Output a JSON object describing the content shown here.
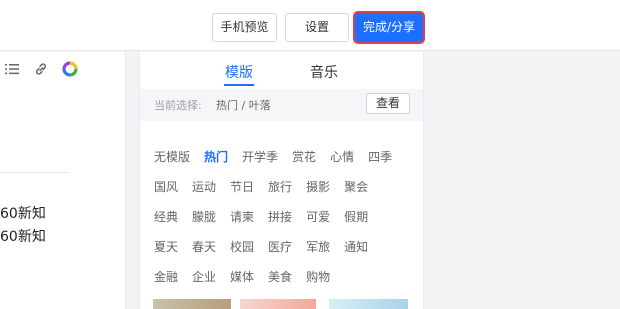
{
  "toolbar": {
    "preview_label": "手机预览",
    "settings_label": "设置",
    "done_label": "完成/分享"
  },
  "editor": {
    "icons": [
      "list-icon",
      "link-icon",
      "color-wheel-icon"
    ],
    "lines": [
      "60新知",
      "60新知"
    ]
  },
  "panel": {
    "tabs": [
      {
        "label": "模版",
        "active": true
      },
      {
        "label": "音乐",
        "active": false
      }
    ],
    "selection_label": "当前选择:",
    "selection_value": "热门 / 叶落",
    "view_button": "查看",
    "categories": [
      [
        "无模版",
        "热门",
        "开学季",
        "赏花",
        "心情",
        "四季"
      ],
      [
        "国风",
        "运动",
        "节日",
        "旅行",
        "摄影",
        "聚会"
      ],
      [
        "经典",
        "朦胧",
        "请柬",
        "拼接",
        "可爱",
        "假期"
      ],
      [
        "夏天",
        "春天",
        "校园",
        "医疗",
        "军旅",
        "通知"
      ],
      [
        "金融",
        "企业",
        "媒体",
        "美食",
        "购物"
      ]
    ],
    "active_category": "热门"
  },
  "colors": {
    "accent": "#1e6fff",
    "focus_ring": "#e0404b"
  }
}
